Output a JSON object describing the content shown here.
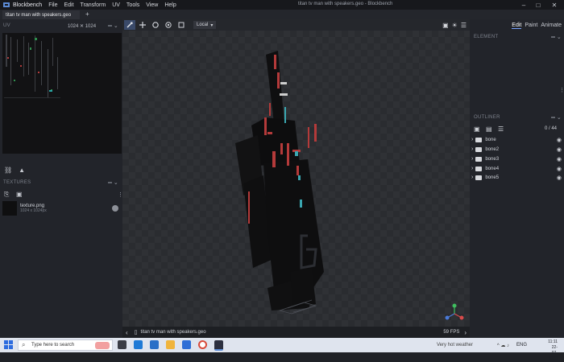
{
  "app": {
    "name": "Blockbench",
    "window_title": "titan tv man with speakers.geo - Blockbench",
    "menu": [
      "File",
      "Edit",
      "Transform",
      "UV",
      "Tools",
      "View",
      "Help"
    ]
  },
  "tabs": [
    {
      "label": "titan tv man with speakers.geo"
    }
  ],
  "uv_panel": {
    "title": "UV",
    "size": "1024 ✕ 1024"
  },
  "textures_panel": {
    "title": "TEXTURES",
    "texture": {
      "name": "texture.png",
      "size": "1024 x 1024px"
    }
  },
  "viewport": {
    "transform_space": "Local",
    "model_name": "titan tv man with speakers.geo",
    "fps": "59 FPS"
  },
  "mode_tabs": [
    "Edit",
    "Paint",
    "Animate"
  ],
  "element_panel": {
    "title": "ELEMENT"
  },
  "outliner": {
    "title": "OUTLINER",
    "count": "0 / 44",
    "items": [
      "bone",
      "bone2",
      "bone3",
      "bone4",
      "bone5"
    ]
  },
  "taskbar": {
    "search_placeholder": "Type here to search",
    "weather": "Very hot weather",
    "lang": "ENG",
    "time": "11:11",
    "date": "22-07-2023"
  }
}
